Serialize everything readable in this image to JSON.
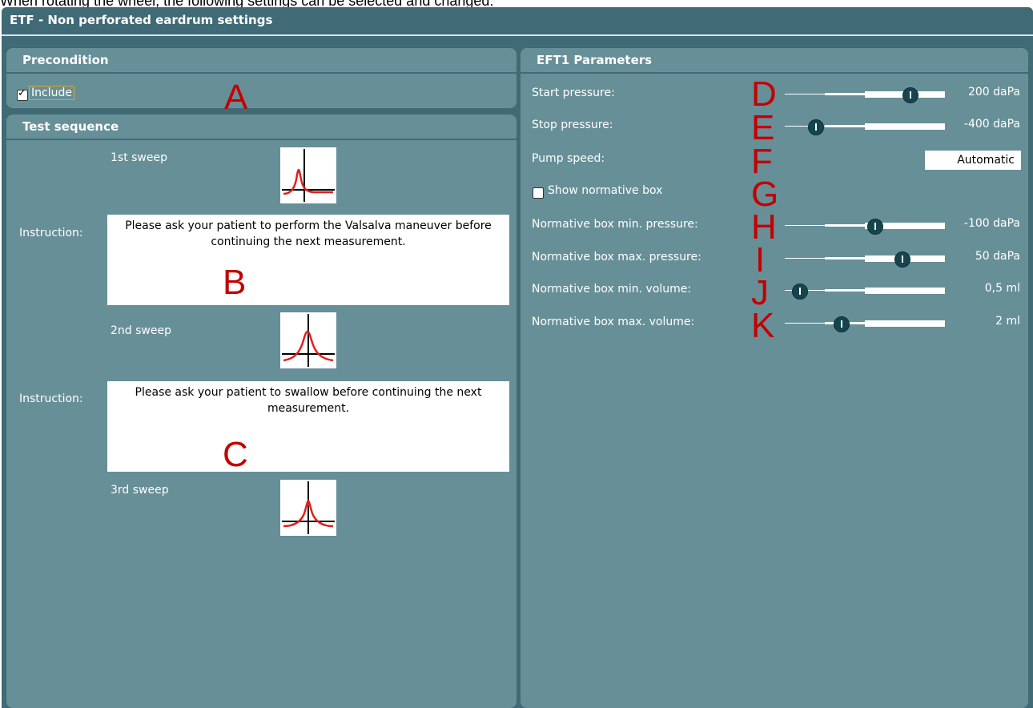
{
  "caption": "When rotating the wheel, the following settings can be selected and changed:",
  "window": {
    "title": "ETF - Non perforated eardrum settings"
  },
  "precondition": {
    "header": "Precondition",
    "include_label": "Include",
    "include_checked": true,
    "marker": "A"
  },
  "test_sequence": {
    "header": "Test sequence",
    "sweep1_label": "1st sweep",
    "instruction_label_1": "Instruction:",
    "instruction1_text": "Please ask your patient to perform the Valsalva maneuver before continuing the next measurement.",
    "marker_b": "B",
    "sweep2_label": "2nd sweep",
    "instruction_label_2": "Instruction:",
    "instruction2_text": "Please ask your patient to swallow before continuing the next measurement.",
    "marker_c": "C",
    "sweep3_label": "3rd sweep"
  },
  "params": {
    "header": "EFT1 Parameters",
    "start_pressure": {
      "label": "Start pressure:",
      "value": "200 daPa",
      "marker": "D",
      "fraction": 0.78
    },
    "stop_pressure": {
      "label": "Stop pressure:",
      "value": "-400 daPa",
      "marker": "E",
      "fraction": 0.19
    },
    "pump_speed": {
      "label": "Pump speed:",
      "value": "Automatic",
      "marker": "F"
    },
    "show_normative": {
      "label": "Show normative box",
      "checked": false,
      "marker": "G"
    },
    "norm_min_pressure": {
      "label": "Normative box min. pressure:",
      "value": "-100 daPa",
      "marker": "H",
      "fraction": 0.56
    },
    "norm_max_pressure": {
      "label": "Normative box max. pressure:",
      "value": "50 daPa",
      "marker": "I",
      "fraction": 0.73
    },
    "norm_min_volume": {
      "label": "Normative box min. volume:",
      "value": "0,5 ml",
      "marker": "J",
      "fraction": 0.09
    },
    "norm_max_volume": {
      "label": "Normative box max. volume:",
      "value": "2 ml",
      "marker": "K",
      "fraction": 0.35
    }
  },
  "colors": {
    "window_bg": "#3f6a76",
    "panel_bg": "#678f98",
    "marker": "#c40000",
    "curve": "#e0201e"
  }
}
